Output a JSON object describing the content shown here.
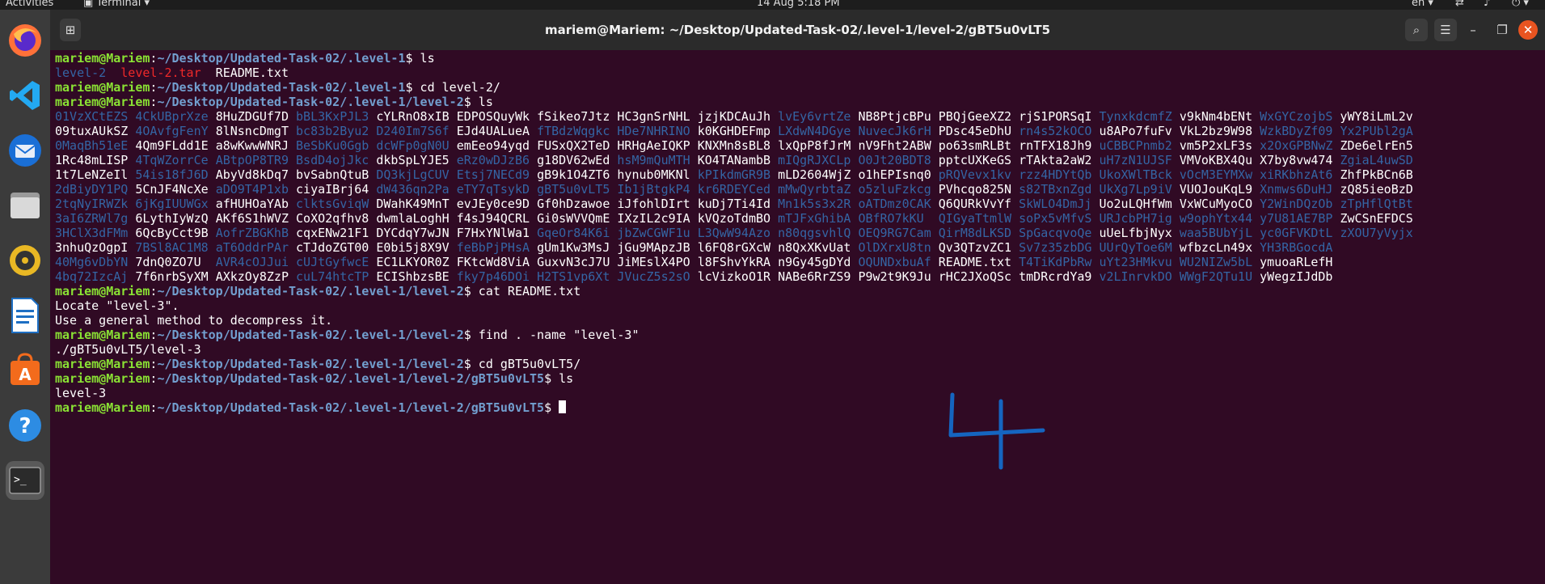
{
  "topbar": {
    "activities": "Activities",
    "app": "Terminal",
    "clock": "14 Aug  5:18 PM",
    "lang": "en"
  },
  "dock": {
    "items": [
      "firefox-icon",
      "vscode-icon",
      "thunderbird-icon",
      "files-icon",
      "rhythmbox-icon",
      "writer-icon",
      "software-icon",
      "help-icon",
      "terminal-icon"
    ]
  },
  "window": {
    "title": "mariem@Mariem: ~/Desktop/Updated-Task-02/.level-1/level-2/gBT5u0vLT5"
  },
  "terminal": {
    "user": "mariem@Mariem",
    "lines": [
      {
        "path": "~/Desktop/Updated-Task-02/.level-1",
        "cmd": "ls"
      },
      {
        "out": [
          [
            "level-2",
            "d"
          ],
          [
            "  ",
            ""
          ],
          [
            "level-2.tar",
            "r"
          ],
          [
            "  README.txt",
            ""
          ]
        ]
      },
      {
        "path": "~/Desktop/Updated-Task-02/.level-1",
        "cmd": "cd level-2/"
      },
      {
        "path": "~/Desktop/Updated-Task-02/.level-1/level-2",
        "cmd": "ls"
      },
      {
        "grid": true
      },
      {
        "path": "~/Desktop/Updated-Task-02/.level-1/level-2",
        "cmd": "cat README.txt"
      },
      {
        "out": [
          [
            "Locate \"level-3\".",
            ""
          ]
        ]
      },
      {
        "out": [
          [
            "Use a general method to decompress it.",
            ""
          ]
        ]
      },
      {
        "path": "~/Desktop/Updated-Task-02/.level-1/level-2",
        "cmd": "find . -name \"level-3\""
      },
      {
        "out": [
          [
            "./gBT5u0vLT5/level-3",
            ""
          ]
        ]
      },
      {
        "path": "~/Desktop/Updated-Task-02/.level-1/level-2",
        "cmd": "cd gBT5u0vLT5/"
      },
      {
        "path": "~/Desktop/Updated-Task-02/.level-1/level-2/gBT5u0vLT5",
        "cmd": "ls"
      },
      {
        "out": [
          [
            "level-3",
            ""
          ]
        ]
      },
      {
        "path": "~/Desktop/Updated-Task-02/.level-1/level-2/gBT5u0vLT5",
        "cmd": "",
        "cursor": true
      }
    ],
    "grid_rows": [
      [
        [
          "01VzXCtEZS",
          "d"
        ],
        [
          "4CkUBprXze",
          "d"
        ],
        [
          "8HuZDGUf7D",
          ""
        ],
        [
          "bBL3KxPJL3",
          "d"
        ],
        [
          "cYLRnO8xIB",
          ""
        ],
        [
          "EDPOSQuyWk",
          ""
        ],
        [
          "fSikeo7Jtz",
          ""
        ],
        [
          "HC3gnSrNHL",
          ""
        ],
        [
          "jzjKDCAuJh",
          ""
        ],
        [
          "lvEy6vrtZe",
          "d"
        ],
        [
          "NB8PtjcBPu",
          ""
        ],
        [
          "PBQjGeeXZ2",
          ""
        ],
        [
          "rjS1PORSqI",
          ""
        ],
        [
          "TynxkdcmfZ",
          "d"
        ],
        [
          "v9kNm4bENt",
          ""
        ],
        [
          "WxGYCzojbS",
          "d"
        ],
        [
          "yWY8iLmL2v",
          ""
        ]
      ],
      [
        [
          "09tuxAUkSZ",
          ""
        ],
        [
          "4OAvfgFenY",
          "d"
        ],
        [
          "8lNsncDmgT",
          ""
        ],
        [
          "bc83b2Byu2",
          "d"
        ],
        [
          "D240Im7S6f",
          "d"
        ],
        [
          "EJd4UALueA",
          ""
        ],
        [
          "fTBdzWqgkc",
          "d"
        ],
        [
          "HDe7NHRINO",
          "d"
        ],
        [
          "k0KGHDEFmp",
          ""
        ],
        [
          "LXdwN4DGye",
          "d"
        ],
        [
          "NuvecJk6rH",
          "d"
        ],
        [
          "PDsc45eDhU",
          ""
        ],
        [
          "rn4s52kOCO",
          "d"
        ],
        [
          "u8APo7fuFv",
          ""
        ],
        [
          "VkL2bz9W98",
          ""
        ],
        [
          "WzkBDyZf09",
          "d"
        ],
        [
          "Yx2PUbl2gA",
          "d"
        ]
      ],
      [
        [
          "0MaqBh51eE",
          "d"
        ],
        [
          "4Qm9FLdd1E",
          ""
        ],
        [
          "a8wKwwWNRJ",
          ""
        ],
        [
          "BeSbKu0Ggb",
          "d"
        ],
        [
          "dcWFp0gN0U",
          "d"
        ],
        [
          "emEeo94yqd",
          ""
        ],
        [
          "FUSxQX2TeD",
          ""
        ],
        [
          "HRHgAeIQKP",
          ""
        ],
        [
          "KNXMn8sBL8",
          ""
        ],
        [
          "lxQpP8fJrM",
          ""
        ],
        [
          "nV9Fht2ABW",
          ""
        ],
        [
          "po63smRLBt",
          ""
        ],
        [
          "rnTFX18Jh9",
          ""
        ],
        [
          "uCBBCPnmb2",
          "d"
        ],
        [
          "vm5P2xLF3s",
          ""
        ],
        [
          "x2OxGPBNwZ",
          "d"
        ],
        [
          "ZDe6elrEn5",
          ""
        ]
      ],
      [
        [
          "1Rc48mLISP",
          ""
        ],
        [
          "4TqWZorrCe",
          "d"
        ],
        [
          "ABtpOP8TR9",
          "d"
        ],
        [
          "BsdD4ojJkc",
          "d"
        ],
        [
          "dkbSpLYJE5",
          ""
        ],
        [
          "eRz0wDJzB6",
          "d"
        ],
        [
          "g18DV62wEd",
          ""
        ],
        [
          "hsM9mQuMTH",
          "d"
        ],
        [
          "KO4TANambB",
          ""
        ],
        [
          "mIQgRJXCLp",
          "d"
        ],
        [
          "O0Jt20BDT8",
          "d"
        ],
        [
          "pptcUXKeGS",
          ""
        ],
        [
          "rTAkta2aW2",
          ""
        ],
        [
          "uH7zN1UJSF",
          "d"
        ],
        [
          "VMVoKBX4Qu",
          ""
        ],
        [
          "X7by8vw474",
          ""
        ],
        [
          "ZgiaL4uwSD",
          "d"
        ]
      ],
      [
        [
          "1t7LeNZeIl",
          ""
        ],
        [
          "54is18fJ6D",
          "d"
        ],
        [
          "AbyVd8kDq7",
          ""
        ],
        [
          "bvSabnQtuB",
          ""
        ],
        [
          "DQ3kjLgCUV",
          "d"
        ],
        [
          "Etsj7NECd9",
          "d"
        ],
        [
          "gB9k1O4ZT6",
          ""
        ],
        [
          "hynub0MKNl",
          ""
        ],
        [
          "kPIkdmGR9B",
          "d"
        ],
        [
          "mLD2604WjZ",
          ""
        ],
        [
          "o1hEPIsnq0",
          ""
        ],
        [
          "pRQVevx1kv",
          "d"
        ],
        [
          "rzz4HDYtQb",
          "d"
        ],
        [
          "UkoXWlTBck",
          "d"
        ],
        [
          "vOcM3EYMXw",
          "d"
        ],
        [
          "xiRKbhzAt6",
          "d"
        ],
        [
          "ZhfPkBCn6B",
          ""
        ]
      ],
      [
        [
          "2dBiyDY1PQ",
          "d"
        ],
        [
          "5CnJF4NcXe",
          ""
        ],
        [
          "aDO9T4P1xb",
          "d"
        ],
        [
          "ciyaIBrj64",
          ""
        ],
        [
          "dW436qn2Pa",
          "d"
        ],
        [
          "eTY7qTsykD",
          "d"
        ],
        [
          "gBT5u0vLT5",
          "d"
        ],
        [
          "Ib1jBtgkP4",
          "d"
        ],
        [
          "kr6RDEYCed",
          "d"
        ],
        [
          "mMwQyrbtaZ",
          "d"
        ],
        [
          "o5zluFzkcg",
          "d"
        ],
        [
          "PVhcqo825N",
          ""
        ],
        [
          "s82TBxnZgd",
          "d"
        ],
        [
          "UkXg7Lp9iV",
          "d"
        ],
        [
          "VUOJouKqL9",
          ""
        ],
        [
          "Xnmws6DuHJ",
          "d"
        ],
        [
          "zQ85ieoBzD",
          ""
        ]
      ],
      [
        [
          "2tqNyIRWZk",
          "d"
        ],
        [
          "6jKgIUUWGx",
          "d"
        ],
        [
          "afHUHOaYAb",
          ""
        ],
        [
          "clktsGviqW",
          "d"
        ],
        [
          "DWahK49MnT",
          ""
        ],
        [
          "evJEy0ce9D",
          ""
        ],
        [
          "Gf0hDzawoe",
          ""
        ],
        [
          "iJfohlDIrt",
          ""
        ],
        [
          "kuDj7Ti4Id",
          ""
        ],
        [
          "Mn1k5s3x2R",
          "d"
        ],
        [
          "oATDmz0CAK",
          "d"
        ],
        [
          "Q6QURkVvYf",
          ""
        ],
        [
          "SkWLO4DmJj",
          "d"
        ],
        [
          "Uo2uLQHfWm",
          ""
        ],
        [
          "VxWCuMyoCO",
          ""
        ],
        [
          "Y2WinDQzOb",
          "d"
        ],
        [
          "zTpHflQtBt",
          "d"
        ]
      ],
      [
        [
          "3aI6ZRWl7g",
          "d"
        ],
        [
          "6LythIyWzQ",
          ""
        ],
        [
          "AKf6S1hWVZ",
          ""
        ],
        [
          "CoXO2qfhv8",
          ""
        ],
        [
          "dwmlaLoghH",
          ""
        ],
        [
          "f4sJ94QCRL",
          ""
        ],
        [
          "Gi0sWVVQmE",
          ""
        ],
        [
          "IXzIL2c9IA",
          ""
        ],
        [
          "kVQzoTdmBO",
          ""
        ],
        [
          "mTJFxGhibA",
          "d"
        ],
        [
          "OBfRO7kKU",
          "d"
        ],
        [
          "QIGyaTtmlW",
          "d"
        ],
        [
          "soPx5vMfvS",
          "d"
        ],
        [
          "URJcbPH7ig",
          "d"
        ],
        [
          "w9ophYtx44",
          "d"
        ],
        [
          "y7U81AE7BP",
          "d"
        ],
        [
          "ZwCSnEFDCS",
          ""
        ]
      ],
      [
        [
          "3HClX3dFMm",
          "d"
        ],
        [
          "6QcByCct9B",
          ""
        ],
        [
          "AofrZBGKhB",
          "d"
        ],
        [
          "cqxENw21F1",
          ""
        ],
        [
          "DYCdqY7wJN",
          ""
        ],
        [
          "F7HxYNlWa1",
          ""
        ],
        [
          "GqeOr84K6i",
          "d"
        ],
        [
          "jbZwCGWF1u",
          "d"
        ],
        [
          "L3QwW94Azo",
          "d"
        ],
        [
          "n80qgsvhlQ",
          "d"
        ],
        [
          "OEQ9RG7Cam",
          "d"
        ],
        [
          "QirM8dLKSD",
          "d"
        ],
        [
          "SpGacqvoQe",
          "d"
        ],
        [
          "uUeLfbjNyx",
          ""
        ],
        [
          "waa5BUbYjL",
          "d"
        ],
        [
          "yc0GFVKDtL",
          "d"
        ],
        [
          "zXOU7yVyjx",
          "d"
        ]
      ],
      [
        [
          "3nhuQzOgpI",
          ""
        ],
        [
          "7BSl8AC1M8",
          "d"
        ],
        [
          "aT6OddrPAr",
          "d"
        ],
        [
          "cTJdoZGT00",
          ""
        ],
        [
          "E0bi5j8X9V",
          ""
        ],
        [
          "feBbPjPHsA",
          "d"
        ],
        [
          "gUm1Kw3MsJ",
          ""
        ],
        [
          "jGu9MApzJB",
          ""
        ],
        [
          "l6FQ8rGXcW",
          ""
        ],
        [
          "n8QxXKvUat",
          ""
        ],
        [
          "OlDXrxU8tn",
          "d"
        ],
        [
          "Qv3QTzvZC1",
          ""
        ],
        [
          "Sv7z35zbDG",
          "d"
        ],
        [
          "UUrQyToe6M",
          "d"
        ],
        [
          "wfbzcLn49x",
          ""
        ],
        [
          "YH3RBGocdA",
          "d"
        ]
      ],
      [
        [
          "40Mg6vDbYN",
          "d"
        ],
        [
          "7dnQ0ZO7U",
          ""
        ],
        [
          "AVR4cOJJui",
          "d"
        ],
        [
          "cUJtGyfwcE",
          "d"
        ],
        [
          "EC1LKYOR0Z",
          ""
        ],
        [
          "FKtcWd8ViA",
          ""
        ],
        [
          "GuxvN3cJ7U",
          ""
        ],
        [
          "JiMEslX4PO",
          ""
        ],
        [
          "l8FShvYkRA",
          ""
        ],
        [
          "n9Gy45gDYd",
          ""
        ],
        [
          "OQUNDxbuAf",
          "d"
        ],
        [
          "README.txt",
          ""
        ],
        [
          "T4TiKdPbRw",
          "d"
        ],
        [
          "uYt23HMkvu",
          "d"
        ],
        [
          "WU2NIZw5bL",
          "d"
        ],
        [
          "ymuoaRLefH",
          ""
        ]
      ],
      [
        [
          "4bq72IzcAj",
          "d"
        ],
        [
          "7f6nrbSyXM",
          ""
        ],
        [
          "AXkzOy8ZzP",
          ""
        ],
        [
          "cuL74htcTP",
          "d"
        ],
        [
          "ECIShbzsBE",
          ""
        ],
        [
          "fky7p46DOi",
          "d"
        ],
        [
          "H2TS1vp6Xt",
          "d"
        ],
        [
          "JVucZ5s2sO",
          "d"
        ],
        [
          "lcVizkoO1R",
          ""
        ],
        [
          "NABe6RrZS9",
          ""
        ],
        [
          "P9w2t9K9Ju",
          ""
        ],
        [
          "rHC2JXoQSc",
          ""
        ],
        [
          "tmDRcrdYa9",
          ""
        ],
        [
          "v2LInrvkDO",
          "d"
        ],
        [
          "WWgF2QTu1U",
          "d"
        ],
        [
          "yWegzIJdDb",
          ""
        ]
      ]
    ]
  },
  "annotation": {
    "text": "4",
    "color": "#1565c0"
  }
}
